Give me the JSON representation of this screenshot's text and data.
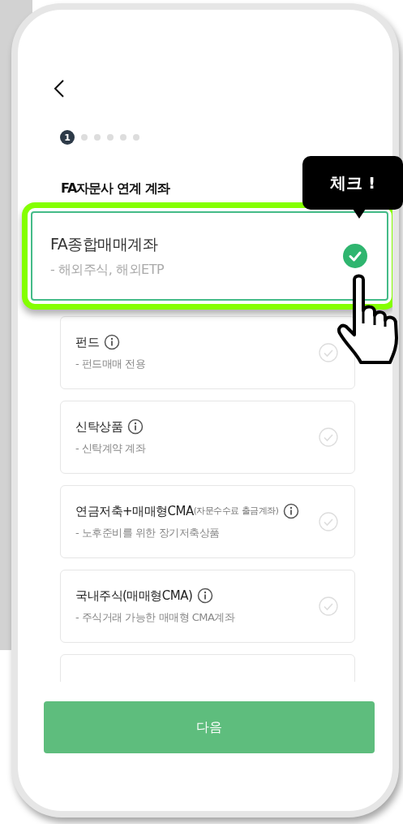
{
  "steps": [
    {
      "label": "1",
      "selected": true
    },
    {
      "selected": false
    },
    {
      "selected": false
    },
    {
      "selected": false
    },
    {
      "selected": false
    },
    {
      "selected": false
    }
  ],
  "section_title": "FA자문사 연계 계좌",
  "items": [
    {
      "kind": "card",
      "title": "FA종합매매계좌",
      "subtitle": "- 해외주식, 해외ETP",
      "info": false,
      "selected": true
    },
    {
      "kind": "card",
      "title": "펀드",
      "subtitle": "- 펀드매매 전용",
      "info": true,
      "selected": false
    },
    {
      "kind": "card",
      "title": "신탁상품",
      "subtitle": "- 신탁계약 계좌",
      "info": true,
      "selected": false
    },
    {
      "kind": "card",
      "title": "연금저축+매매형CMA",
      "note": "(자문수수료 출금계좌)",
      "subtitle": "- 노후준비를 위한 장기저축상품",
      "info": true,
      "selected": false
    },
    {
      "kind": "card",
      "title": "국내주식(매매형CMA)",
      "subtitle": "- 주식거래 가능한 매매형 CMA계좌",
      "info": true,
      "selected": false
    },
    {
      "kind": "cut"
    }
  ],
  "next_button": "다음",
  "tooltip": "체크 !"
}
